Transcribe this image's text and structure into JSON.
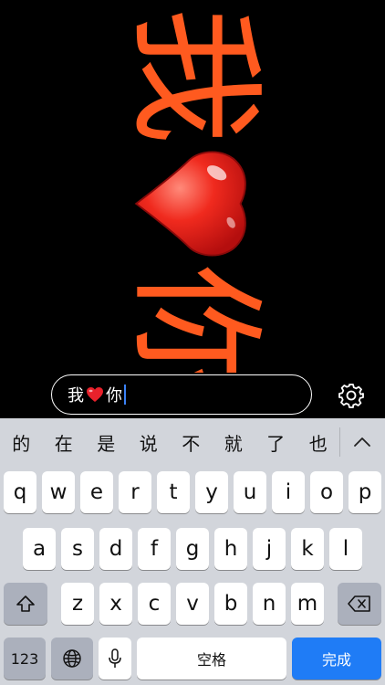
{
  "display": {
    "char_top": "我",
    "char_bottom": "你",
    "heart_icon": "red-heart-emoji",
    "text_color": "#FF5A1F"
  },
  "input": {
    "before_heart": "我",
    "after_heart": "你"
  },
  "candidates": [
    "的",
    "在",
    "是",
    "说",
    "不",
    "就",
    "了",
    "也"
  ],
  "keyboard": {
    "row1": [
      "q",
      "w",
      "e",
      "r",
      "t",
      "y",
      "u",
      "i",
      "o",
      "p"
    ],
    "row2": [
      "a",
      "s",
      "d",
      "f",
      "g",
      "h",
      "j",
      "k",
      "l"
    ],
    "row3": [
      "z",
      "x",
      "c",
      "v",
      "b",
      "n",
      "m"
    ],
    "numbers_label": "123",
    "space_label": "空格",
    "done_label": "完成",
    "done_color": "#1F7CF6"
  }
}
